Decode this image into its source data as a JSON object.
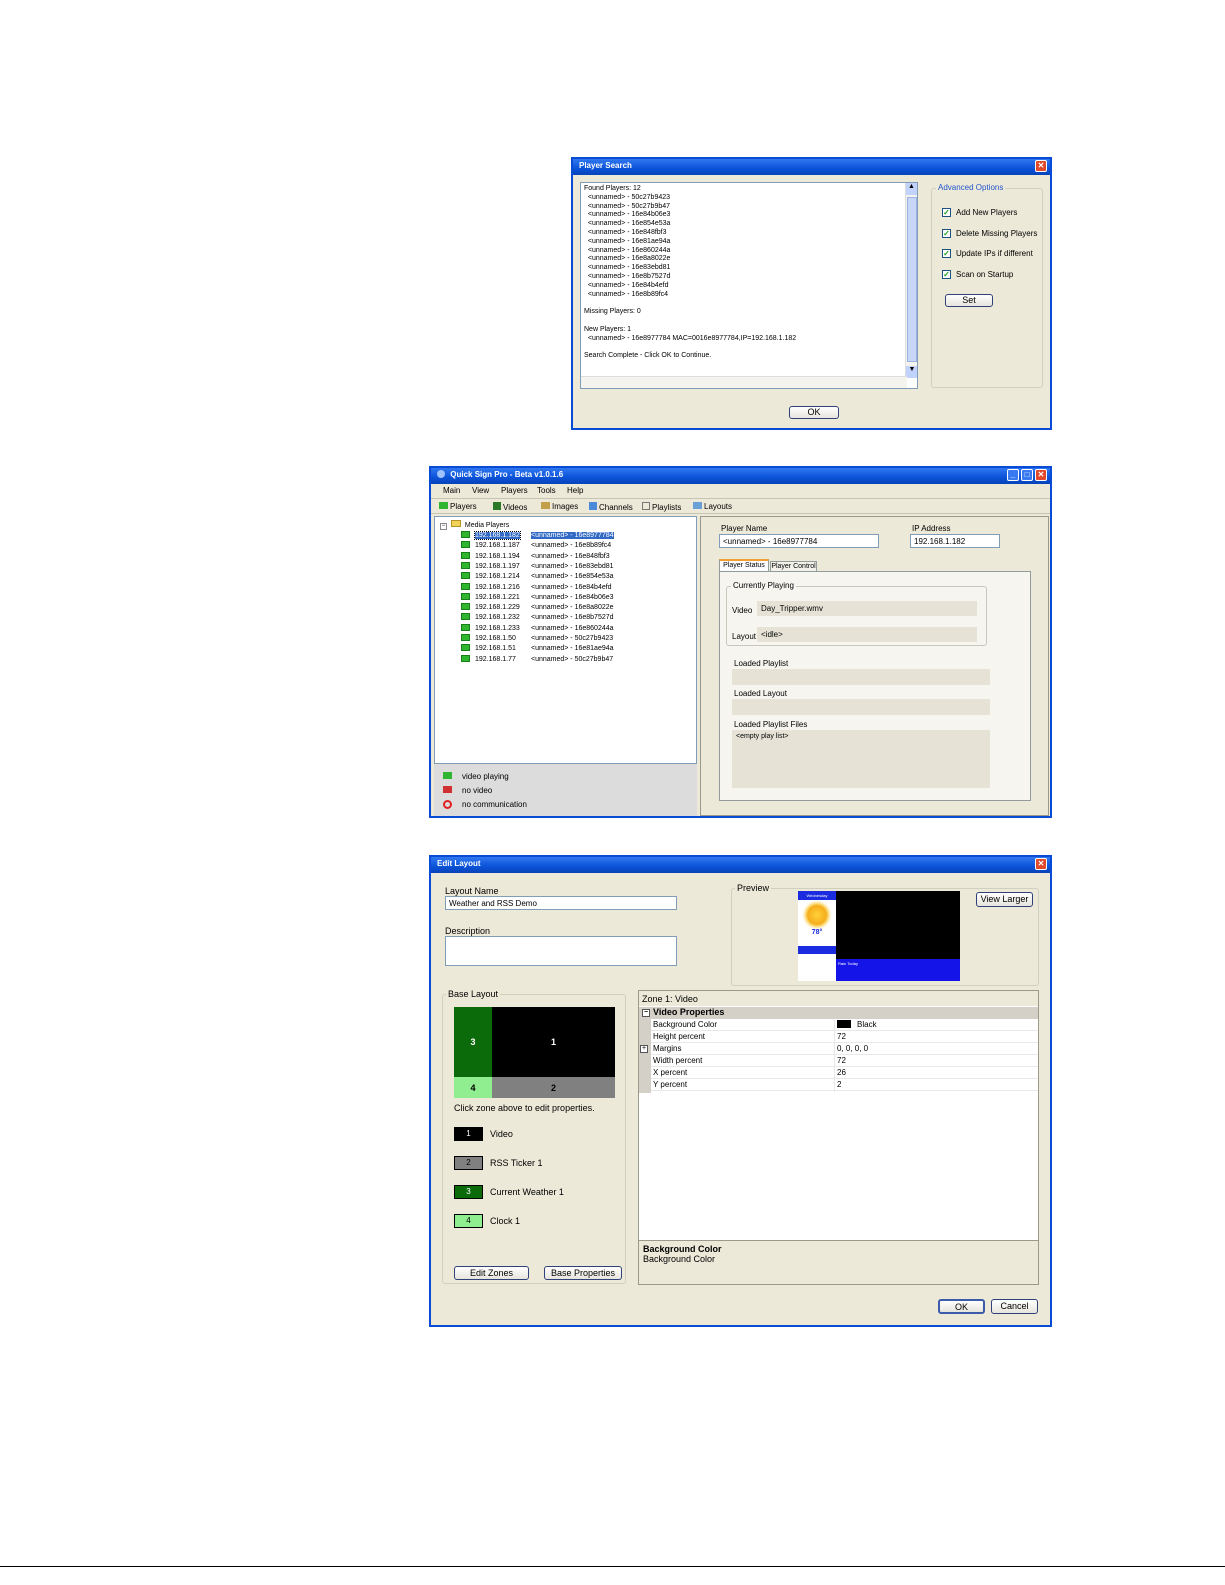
{
  "player_search": {
    "title": "Player Search",
    "results_text": "Found Players: 12\n  <unnamed> - 50c27b9423\n  <unnamed> - 50c27b9b47\n  <unnamed> - 16e84b06e3\n  <unnamed> - 16e854e53a\n  <unnamed> - 16e848fbf3\n  <unnamed> - 16e81ae94a\n  <unnamed> - 16e860244a\n  <unnamed> - 16e8a8022e\n  <unnamed> - 16e83ebd81\n  <unnamed> - 16e8b7527d\n  <unnamed> - 16e84b4efd\n  <unnamed> - 16e8b89fc4\n\nMissing Players: 0\n\nNew Players: 1\n  <unnamed> - 16e8977784 MAC=0016e8977784,IP=192.168.1.182\n\nSearch Complete - Click OK to Continue.",
    "advanced_title": "Advanced Options",
    "options": [
      {
        "label": "Add New Players",
        "checked": true
      },
      {
        "label": "Delete Missing Players",
        "checked": true
      },
      {
        "label": "Update IPs if different",
        "checked": true
      },
      {
        "label": "Scan on Startup",
        "checked": true
      }
    ],
    "set_label": "Set",
    "ok_label": "OK"
  },
  "main_window": {
    "title": "Quick Sign Pro - Beta v1.0.1.6",
    "menu": [
      "Main",
      "View",
      "Players",
      "Tools",
      "Help"
    ],
    "tabs": [
      "Players",
      "Videos",
      "Images",
      "Channels",
      "Playlists",
      "Layouts"
    ],
    "tree_root": "Media Players",
    "players": [
      {
        "ip": "192.168.1.182",
        "name": "<unnamed> - 16e8977784",
        "selected": true
      },
      {
        "ip": "192.168.1.187",
        "name": "<unnamed> - 16e8b89fc4"
      },
      {
        "ip": "192.168.1.194",
        "name": "<unnamed> - 16e848fbf3"
      },
      {
        "ip": "192.168.1.197",
        "name": "<unnamed> - 16e83ebd81"
      },
      {
        "ip": "192.168.1.214",
        "name": "<unnamed> - 16e854e53a"
      },
      {
        "ip": "192.168.1.216",
        "name": "<unnamed> - 16e84b4efd"
      },
      {
        "ip": "192.168.1.221",
        "name": "<unnamed> - 16e84b06e3"
      },
      {
        "ip": "192.168.1.229",
        "name": "<unnamed> - 16e8a8022e"
      },
      {
        "ip": "192.168.1.232",
        "name": "<unnamed> - 16e8b7527d"
      },
      {
        "ip": "192.168.1.233",
        "name": "<unnamed> - 16e860244a"
      },
      {
        "ip": "192.168.1.50",
        "name": "<unnamed> - 50c27b9423"
      },
      {
        "ip": "192.168.1.51",
        "name": "<unnamed> - 16e81ae94a"
      },
      {
        "ip": "192.168.1.77",
        "name": "<unnamed> - 50c27b9b47"
      }
    ],
    "legend": [
      {
        "label": "video playing",
        "color": "#2fb52f"
      },
      {
        "label": "no video",
        "color": "#d03030"
      },
      {
        "label": "no communication",
        "color": "#e02020"
      }
    ],
    "player_name_label": "Player Name",
    "player_name_value": "<unnamed> - 16e8977784",
    "ip_label": "IP Address",
    "ip_value": "192.168.1.182",
    "status_tabs": [
      "Player Status",
      "Player Control"
    ],
    "currently_playing": "Currently Playing",
    "video_label": "Video",
    "video_value": "Day_Tripper.wmv",
    "layout_label": "Layout",
    "layout_value": "<idle>",
    "loaded_playlist": "Loaded Playlist",
    "loaded_layout": "Loaded Layout",
    "loaded_playlist_files": "Loaded Playlist Files",
    "playlist_files_value": "<empty play list>"
  },
  "edit_layout": {
    "title": "Edit Layout",
    "layout_name_label": "Layout Name",
    "layout_name_value": "Weather and RSS Demo",
    "description_label": "Description",
    "description_value": "",
    "preview_label": "Preview",
    "view_larger_label": "View Larger",
    "preview": {
      "day": "Wednesday",
      "temp": "78°",
      "ticker": "Rain Today"
    },
    "base_layout_label": "Base Layout",
    "zones": [
      {
        "num": "1",
        "label": "Video",
        "color": "#000000"
      },
      {
        "num": "2",
        "label": "RSS Ticker 1",
        "color": "#808080"
      },
      {
        "num": "3",
        "label": "Current Weather 1",
        "color": "#0b6b0b"
      },
      {
        "num": "4",
        "label": "Clock 1",
        "color": "#90ee90"
      }
    ],
    "click_hint": "Click zone above to edit properties.",
    "edit_zones_label": "Edit Zones",
    "base_props_label": "Base Properties",
    "zone_header": "Zone 1: Video",
    "prop_group": "Video Properties",
    "props": [
      {
        "name": "Background Color",
        "value": "Black"
      },
      {
        "name": "Height percent",
        "value": "72"
      },
      {
        "name": "Margins",
        "value": "0, 0, 0, 0"
      },
      {
        "name": "Width percent",
        "value": "72"
      },
      {
        "name": "X percent",
        "value": "26"
      },
      {
        "name": "Y percent",
        "value": "2"
      }
    ],
    "help_title": "Background Color",
    "help_text": "Background Color",
    "ok_label": "OK",
    "cancel_label": "Cancel"
  }
}
